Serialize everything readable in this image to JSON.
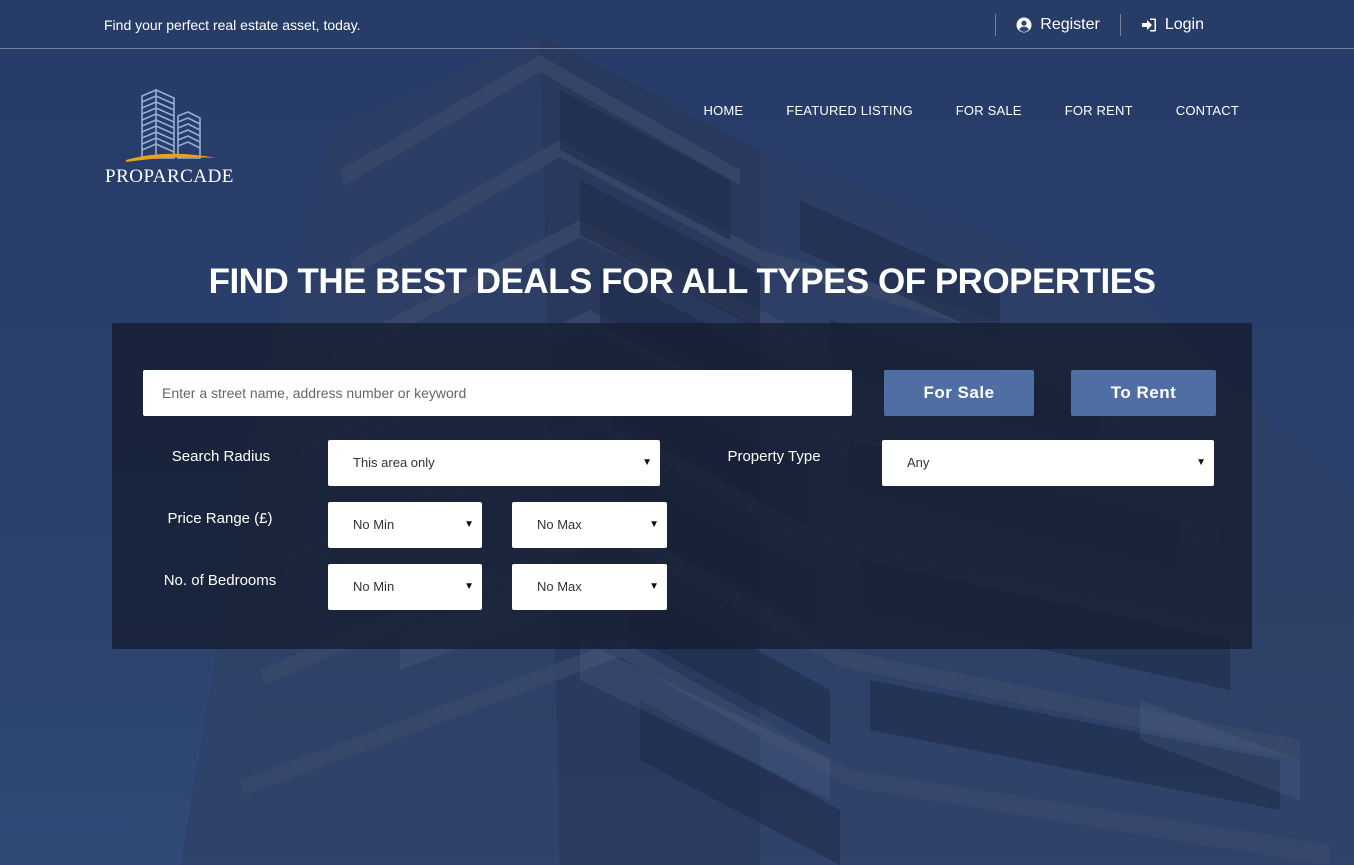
{
  "topbar": {
    "tagline": "Find your perfect real estate asset, today.",
    "register_label": "Register",
    "login_label": "Login"
  },
  "brand": {
    "name": "PROPARCADE"
  },
  "nav": {
    "items": [
      "HOME",
      "FEATURED LISTING",
      "FOR SALE",
      "FOR RENT",
      "CONTACT"
    ]
  },
  "hero": {
    "headline": "FIND THE BEST DEALS FOR ALL TYPES OF PROPERTIES"
  },
  "search": {
    "keyword_placeholder": "Enter a street name, address number or keyword",
    "for_sale_label": "For Sale",
    "to_rent_label": "To Rent",
    "radius": {
      "label": "Search Radius",
      "value": "This area only"
    },
    "property_type": {
      "label": "Property Type",
      "value": "Any"
    },
    "price": {
      "label": "Price Range (£)",
      "min": "No Min",
      "max": "No Max"
    },
    "bedrooms": {
      "label": "No. of Bedrooms",
      "min": "No Min",
      "max": "No Max"
    }
  },
  "colors": {
    "accent_button": "#4f6ea3",
    "panel_bg": "#161f32",
    "logo_swoosh": "#e8a21c"
  }
}
